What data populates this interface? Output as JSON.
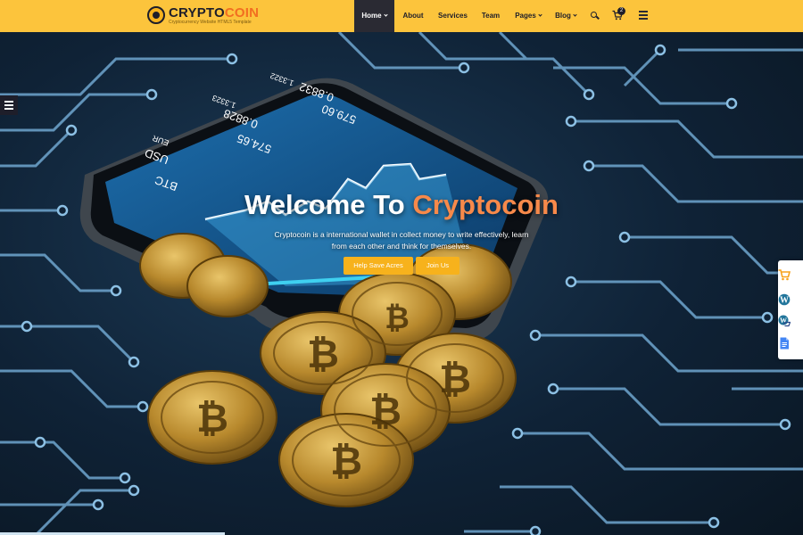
{
  "brand": {
    "name_part1": "CRYPTO",
    "name_part2": "COIN",
    "tagline": "Cryptocurrency Website HTML5 Template"
  },
  "nav": {
    "items": [
      {
        "label": "Home",
        "active": true,
        "dropdown": true
      },
      {
        "label": "About",
        "active": false,
        "dropdown": false
      },
      {
        "label": "Services",
        "active": false,
        "dropdown": false
      },
      {
        "label": "Team",
        "active": false,
        "dropdown": false
      },
      {
        "label": "Pages",
        "active": false,
        "dropdown": true
      },
      {
        "label": "Blog",
        "active": false,
        "dropdown": true
      }
    ],
    "cart_count": "2",
    "icons": [
      "search-icon",
      "cart-icon",
      "hamburger-menu-icon"
    ]
  },
  "hero": {
    "title_part1": "Welcome To ",
    "title_part2": "Cryptocoin",
    "subtitle": "Cryptocoin is a international wallet in collect money to write effectively, learn from each other and think for themselves.",
    "buttons": {
      "primary": "Help Save Acres",
      "secondary": "Join Us"
    },
    "phone_screen": {
      "labels": [
        "BTC",
        "USD",
        "EUR"
      ],
      "values": [
        "574.65",
        "0.8828",
        "579.60",
        "0.8832",
        "1.3323",
        "1.3322"
      ]
    }
  },
  "side_panel": {
    "icons": [
      "cart-icon",
      "wordpress-icon",
      "woocommerce-icon",
      "google-docs-icon"
    ]
  },
  "colors": {
    "header_bg": "#fcc43c",
    "nav_active_bg": "#2a2a33",
    "accent_orange": "#f7894a",
    "button_yellow": "#f7b21c",
    "circuit_blue": "#6fa6cf"
  }
}
